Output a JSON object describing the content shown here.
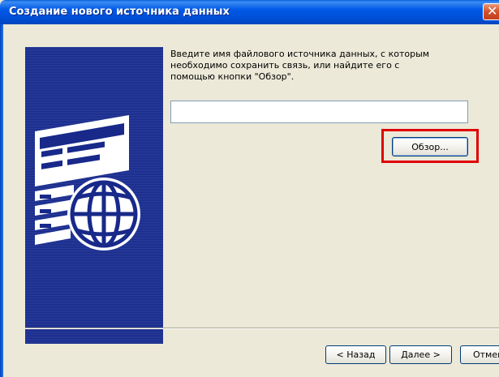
{
  "window": {
    "title": "Создание нового источника данных",
    "close_glyph": "✕"
  },
  "banner": {
    "icon": "data-source-globe-icon",
    "color_dark": "#18298a",
    "color_light": "#2a3e9a"
  },
  "main": {
    "instruction": "Введите имя файлового источника данных, с которым\nнеобходимо сохранить связь, или найдите его с\nпомощью кнопки \"Обзор\".",
    "path_value": "",
    "browse_label": "Обзор..."
  },
  "footer": {
    "back_label": "< Назад",
    "next_label": "Далее >",
    "cancel_label": "Отмена"
  },
  "colors": {
    "highlight_box": "#e00000",
    "title_bar": "#0050d8",
    "dialog_bg": "#ece9d8"
  }
}
